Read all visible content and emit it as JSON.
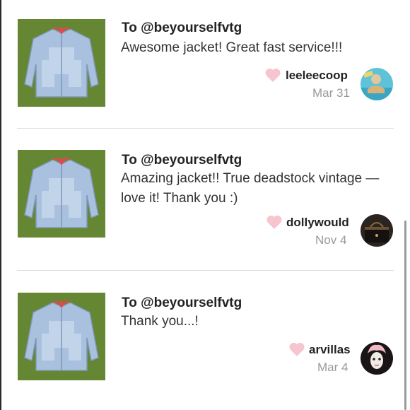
{
  "reviews": [
    {
      "to": "To @beyourselfvtg",
      "comment": "Awesome jacket! Great fast service!!!",
      "username": "leeleecoop",
      "date": "Mar 31"
    },
    {
      "to": "To @beyourselfvtg",
      "comment": "Amazing jacket!! True deadstock vintage — love it! Thank you :)",
      "username": "dollywould",
      "date": "Nov 4"
    },
    {
      "to": "To @beyourselfvtg",
      "comment": "Thank you...!",
      "username": "arvillas",
      "date": "Mar 4"
    }
  ],
  "colors": {
    "heart": "#f7c5cf",
    "grass": "#5c7d2e",
    "jacket": "#a9c1de",
    "divider": "#dddddd"
  },
  "icons": {
    "heart": "heart-icon",
    "thumbnail": "denim-jacket-photo",
    "avatar": "user-avatar"
  }
}
